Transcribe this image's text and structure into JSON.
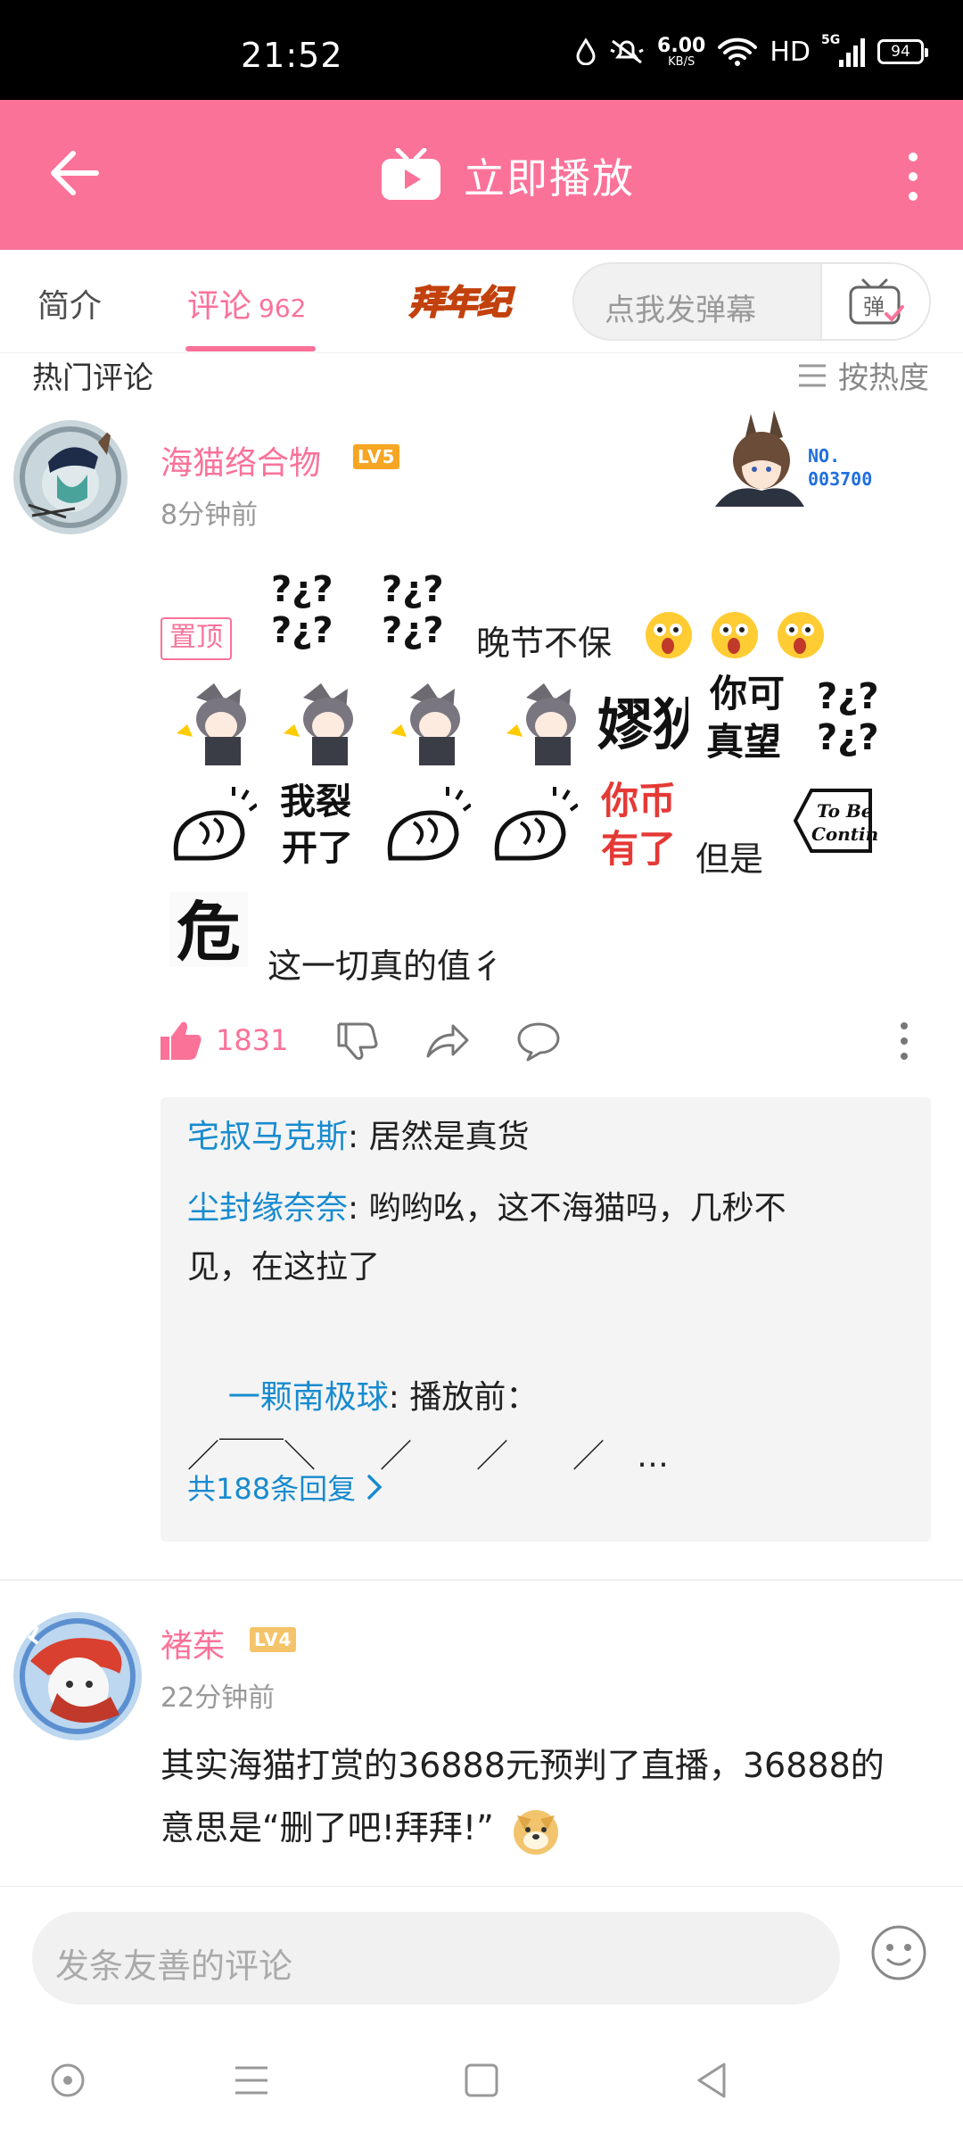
{
  "status_bar": {
    "time": "21:52",
    "net_speed": "6.00",
    "net_unit": "KB/S",
    "hd": "HD",
    "signal": "5G",
    "battery": "94"
  },
  "header": {
    "title": "立即播放"
  },
  "tabs": {
    "intro": "简介",
    "comments": "评论",
    "comments_count": "962",
    "newyear_logo_text": "拜年纪",
    "danmaku_placeholder": "点我发弹幕",
    "danmaku_btn": "弹"
  },
  "hot": {
    "title": "热门评论",
    "sort_label": "按热度"
  },
  "comment1": {
    "user": "海猫络合物",
    "level": "LV5",
    "time": "8分钟前",
    "badge_no": "NO.",
    "badge_num": "003700",
    "pin_label": "置顶",
    "text_a": "晚节不保",
    "sticker_qs": "?¿?\n?¿?",
    "sticker_kx": "嫪狄",
    "sticker_nkzw": "你可\n真望",
    "sticker_wlkl": "我裂\n开了",
    "sticker_nbyl": "你币\n有了",
    "text_b": "但是",
    "sticker_tbc": "To Be\nContinued",
    "sticker_wei": "危",
    "text_c": "这一切真的值彳",
    "likes": "1831",
    "replies": [
      {
        "name": "宅叔马克斯",
        "text": ": 居然是真货"
      },
      {
        "name": "尘封缘奈奈",
        "text": ": 哟哟吆，这不海猫吗，几秒不见，在这拉了"
      },
      {
        "name": "一颗南极球",
        "text": ": 播放前：\n／￣￣＼　　／　　／　　／　…"
      }
    ],
    "more_replies": "共188条回复"
  },
  "comment2": {
    "user": "褚茱",
    "level": "LV4",
    "time": "22分钟前",
    "text": "其实海猫打赏的36888元预判了直播，36888的意思是“删了吧!拜拜!”"
  },
  "bottom": {
    "placeholder": "发条友善的评论"
  },
  "colors": {
    "accent": "#fb7299",
    "link": "#178bcf"
  }
}
